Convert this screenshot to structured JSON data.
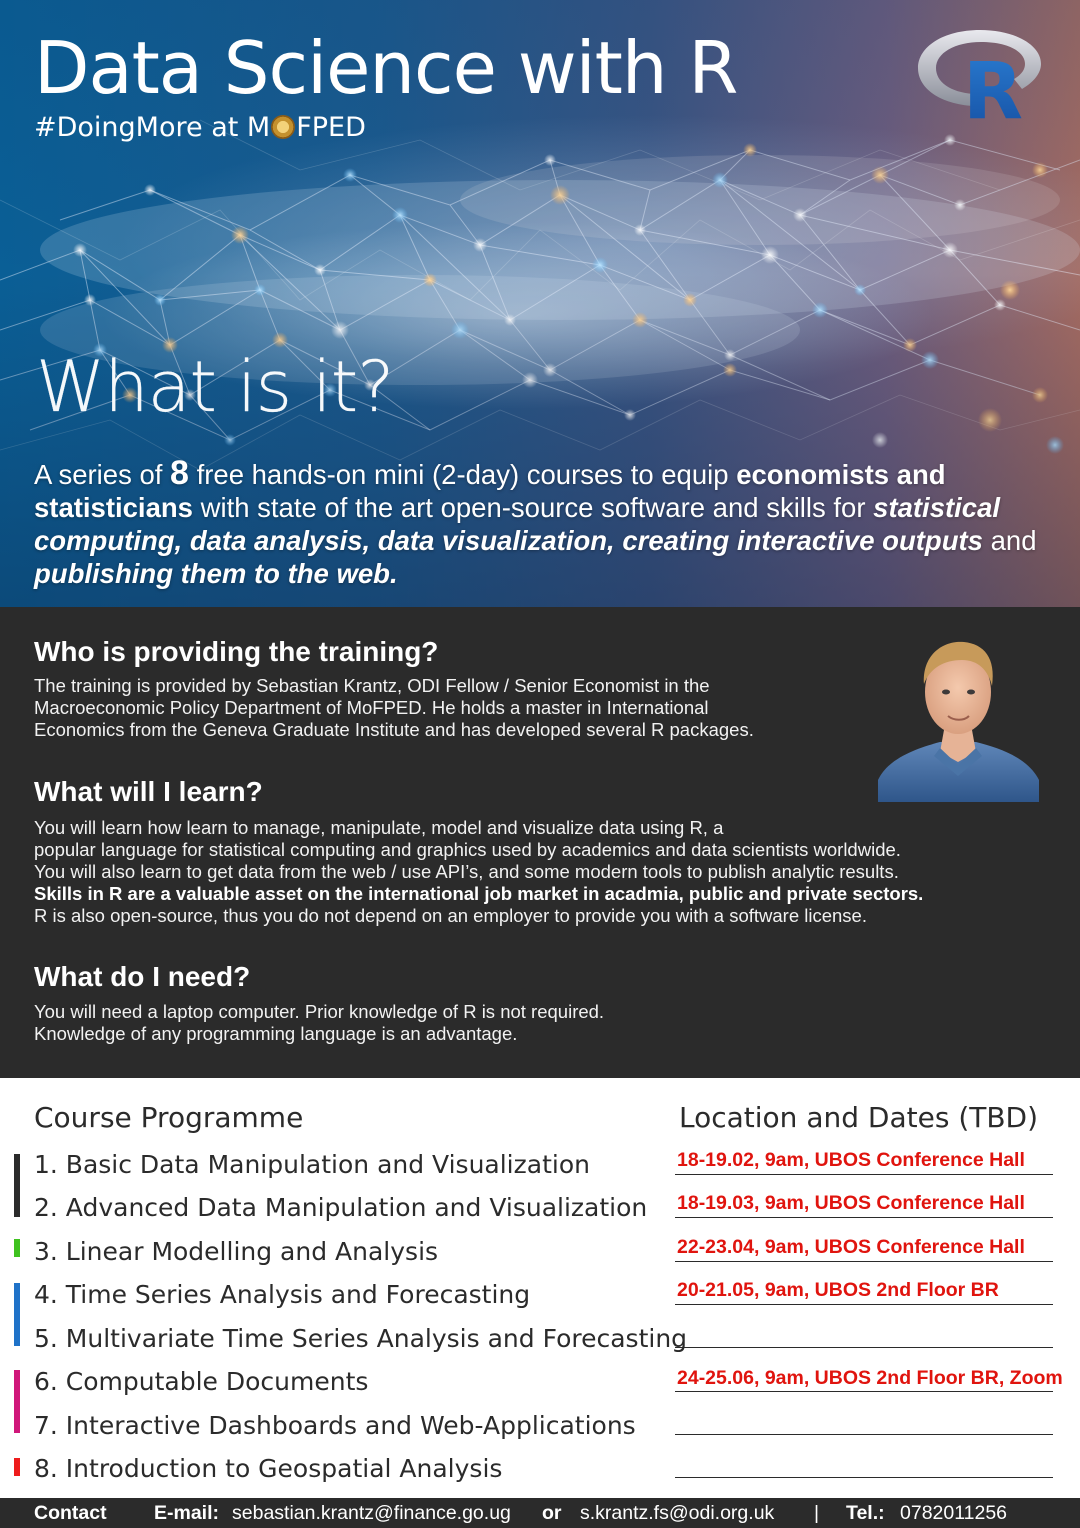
{
  "hero": {
    "title": "Data Science with R",
    "tagline_prefix": "#DoingMore at M",
    "tagline_suffix": "FPED",
    "logo_letter": "R",
    "what_title": "What is it?",
    "description": {
      "t1": "A series of ",
      "count": "8",
      "t2": " free hands-on mini (2-day) courses to equip ",
      "audience": "economists and statisticians",
      "t3": " with state of the art open-source software and skills for ",
      "skills": "statistical computing, data analysis, data visualization, creating interactive outputs",
      "t4": " and ",
      "publishing": "publishing them to the web."
    }
  },
  "who": {
    "heading": "Who is providing the training?",
    "lines": [
      "The training is provided by Sebastian Krantz, ODI Fellow / Senior Economist in the",
      "Macroeconomic Policy Department of MoFPED. He holds a master in International",
      "Economics from the Geneva Graduate Institute and has developed several R packages."
    ]
  },
  "learn": {
    "heading": "What will I learn?",
    "lines": [
      "You will learn how learn to manage, manipulate, model and visualize data using R, a",
      "popular language for statistical computing and graphics used by academics and data scientists worldwide.",
      "You will also learn to get data from the web / use API’s, and some modern tools to publish analytic results."
    ],
    "bold_line": "Skills in R are a valuable asset on the international  job market in acadmia, public and private sectors.",
    "last_line": "R is also open-source, thus you do not depend on an employer to provide you with a software license."
  },
  "need": {
    "heading": "What do I need?",
    "lines": [
      "You will need a laptop computer. Prior knowledge of R is not required.",
      "Knowledge of any programming language is an advantage."
    ]
  },
  "programme": {
    "heading": "Course Programme",
    "location_heading": "Location and Dates (TBD)",
    "courses": [
      "1. Basic Data Manipulation and Visualization",
      "2. Advanced Data Manipulation and Visualization",
      "3. Linear Modelling and Analysis",
      "4. Time Series Analysis and Forecasting",
      "5. Multivariate Time Series Analysis and Forecasting",
      "6. Computable Documents",
      "7. Interactive Dashboards and Web-Applications",
      "8. Introduction to Geospatial Analysis"
    ],
    "dates": [
      "18-19.02, 9am, UBOS Conference Hall",
      "18-19.03, 9am, UBOS Conference Hall",
      "22-23.04, 9am, UBOS Conference Hall",
      "20-21.05, 9am, UBOS 2nd Floor BR",
      "",
      "24-25.06, 9am, UBOS 2nd Floor BR, Zoom",
      "",
      ""
    ],
    "marker_colors": {
      "basic": "#2b2b2b",
      "linear": "#3fc21f",
      "timeseries": "#1f72c8",
      "documents": "#d0177a",
      "geo": "#ee1c1c"
    }
  },
  "footer": {
    "contact_label": "Contact",
    "email_label": "E-mail:",
    "email_1": "sebastian.krantz@finance.go.ug",
    "or": "or",
    "email_2": "s.krantz.fs@odi.org.uk",
    "separator": "|",
    "tel_label": "Tel.:",
    "tel": "0782011256"
  }
}
